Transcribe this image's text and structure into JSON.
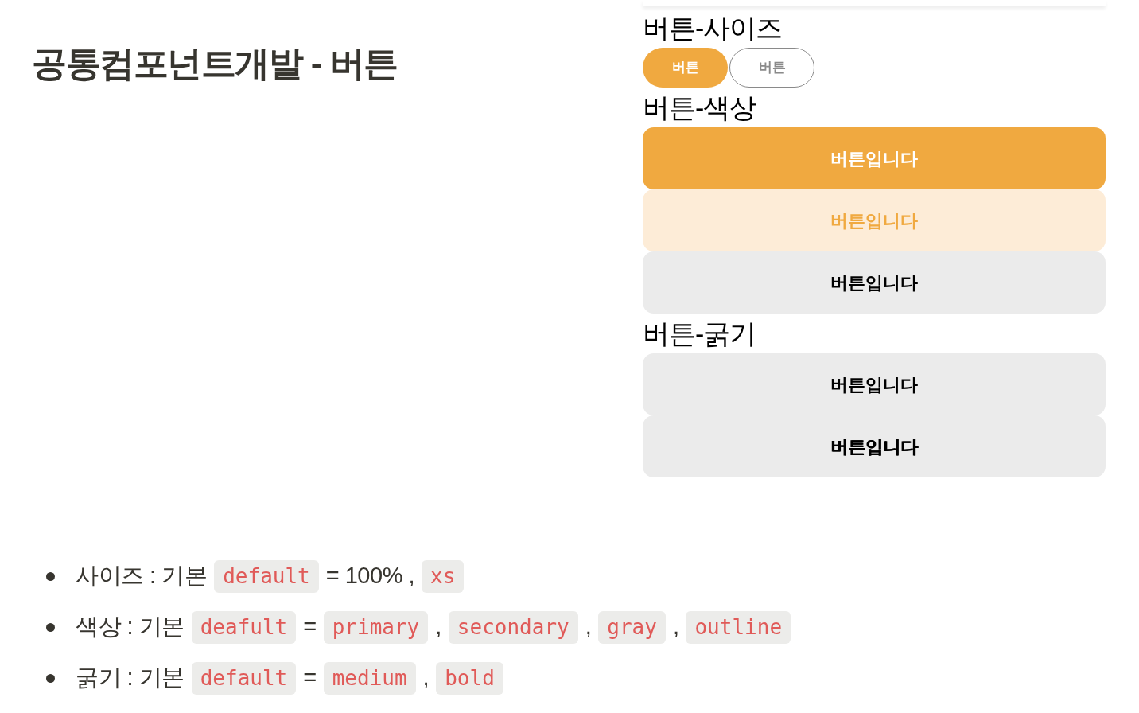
{
  "page_title": "공통컴포넌트개발 - 버튼",
  "preview": {
    "sections": [
      {
        "heading": "버튼-사이즈",
        "buttons": [
          {
            "label": "버튼",
            "kind": "primary",
            "compact": true,
            "bold": false
          },
          {
            "label": "버튼",
            "kind": "outline",
            "compact": true,
            "bold": false
          }
        ]
      },
      {
        "heading": "버튼-색상",
        "buttons": [
          {
            "label": "버튼입니다",
            "kind": "primary",
            "compact": false,
            "bold": false
          },
          {
            "label": "버튼입니다",
            "kind": "secondary",
            "compact": false,
            "bold": false
          },
          {
            "label": "버튼입니다",
            "kind": "gray",
            "compact": false,
            "bold": false
          }
        ]
      },
      {
        "heading": "버튼-굵기",
        "buttons": [
          {
            "label": "버튼입니다",
            "kind": "gray",
            "compact": false,
            "bold": false
          },
          {
            "label": "버튼입니다",
            "kind": "gray",
            "compact": false,
            "bold": true
          }
        ]
      }
    ]
  },
  "notes": [
    {
      "parts": [
        {
          "kind": "text",
          "text": "사이즈 : 기본"
        },
        {
          "kind": "code",
          "text": "default"
        },
        {
          "kind": "text",
          "text": "= 100% ,"
        },
        {
          "kind": "code",
          "text": "xs"
        }
      ]
    },
    {
      "parts": [
        {
          "kind": "text",
          "text": "색상 : 기본"
        },
        {
          "kind": "code",
          "text": "deafult"
        },
        {
          "kind": "text",
          "text": "="
        },
        {
          "kind": "code",
          "text": "primary"
        },
        {
          "kind": "text",
          "text": ","
        },
        {
          "kind": "code",
          "text": "secondary"
        },
        {
          "kind": "text",
          "text": ","
        },
        {
          "kind": "code",
          "text": "gray"
        },
        {
          "kind": "text",
          "text": ","
        },
        {
          "kind": "code",
          "text": "outline"
        }
      ]
    },
    {
      "parts": [
        {
          "kind": "text",
          "text": "굵기 : 기본"
        },
        {
          "kind": "code",
          "text": "default"
        },
        {
          "kind": "text",
          "text": "="
        },
        {
          "kind": "code",
          "text": "medium"
        },
        {
          "kind": "text",
          "text": ","
        },
        {
          "kind": "code",
          "text": "bold"
        }
      ]
    }
  ]
}
